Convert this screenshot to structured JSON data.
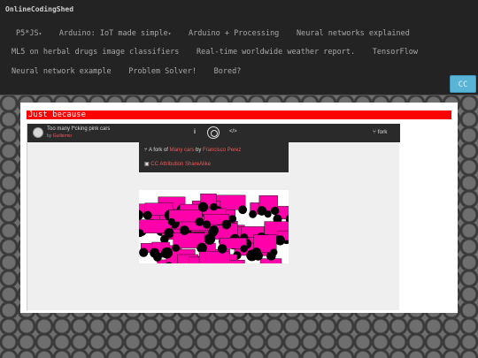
{
  "nav": {
    "brand": "OnlineCodingShed",
    "row1": [
      {
        "label": "P5*JS",
        "dropdown": true
      },
      {
        "label": "Arduino: IoT made simple",
        "dropdown": true
      },
      {
        "label": "Arduino + Processing",
        "dropdown": false
      },
      {
        "label": "Neural networks explained",
        "dropdown": false
      }
    ],
    "row2": [
      "ML5 on herbal drugs image classifiers",
      "Real-time worldwide weather report.",
      "TensorFlow"
    ],
    "row3": [
      "Neural network example",
      "Problem Solver!",
      "Bored?"
    ],
    "cc_button": "CC"
  },
  "content": {
    "section_title": "Just because"
  },
  "embed": {
    "sketch_title": "Too many f*cking pink cars",
    "by_label": "by",
    "author": "Guillermo",
    "info_icon": "i",
    "code_icon": "</>",
    "fork_label": "fork",
    "fork_of_prefix": "A fork of",
    "fork_of_name": "Many cars",
    "fork_of_by": "by",
    "fork_of_author": "Francisco Perez",
    "license": "CC Attribution ShareAlike"
  },
  "colors": {
    "accent_red": "#ff0000",
    "link_red": "#ef5a5a",
    "pink": "#ff00aa",
    "cc_blue": "#5ab4d6"
  },
  "icons": [
    "avatar",
    "info-icon",
    "play-icon",
    "code-icon",
    "fork-icon",
    "license-icon",
    "chevron-down-icon"
  ]
}
